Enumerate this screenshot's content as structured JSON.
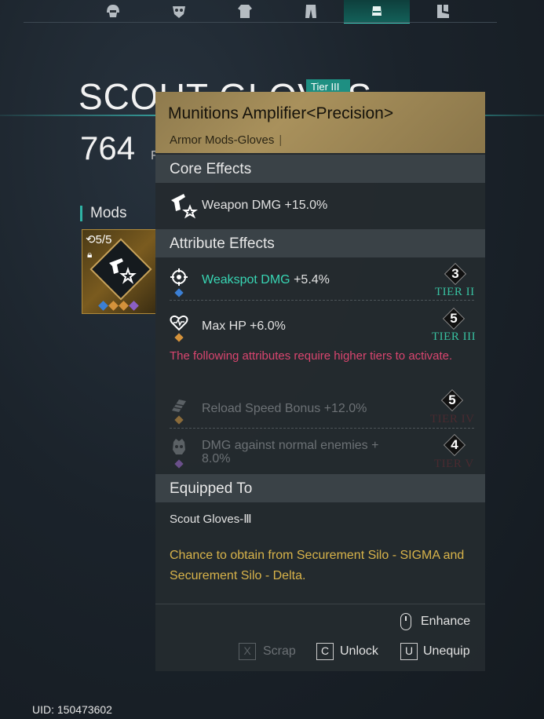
{
  "nav": {
    "tabs": [
      {
        "icon": "helmet-icon",
        "active": false
      },
      {
        "icon": "mask-icon",
        "active": false
      },
      {
        "icon": "top-armor-icon",
        "active": false
      },
      {
        "icon": "pants-icon",
        "active": false
      },
      {
        "icon": "gloves-icon",
        "active": true
      },
      {
        "icon": "boots-icon",
        "active": false
      }
    ]
  },
  "item": {
    "name": "SCOUT GLOVES",
    "tier_badge": "Tier III",
    "level": "764",
    "level_suffix": "F"
  },
  "mods": {
    "label": "Mods",
    "count": "5/5",
    "gem_colors": [
      "#3b7fd4",
      "#d4923b",
      "#d4923b",
      "#8b5fc4"
    ]
  },
  "tooltip": {
    "title": "Munitions Amplifier<Precision>",
    "subtitle": "Armor Mods-Gloves",
    "core_effects": {
      "heading": "Core Effects",
      "label": "Weapon DMG",
      "value": "+15.0%"
    },
    "attribute_effects": {
      "heading": "Attribute Effects",
      "items": [
        {
          "label": "Weakspot DMG",
          "value": "+5.4%",
          "number": "3",
          "tier": "TIER",
          "tier_roman": "II",
          "gem": "#3b7fd4",
          "active": true
        },
        {
          "label": "Max HP",
          "value": "+6.0%",
          "number": "5",
          "tier": "TIER",
          "tier_roman": "III",
          "gem": "#d4923b",
          "active": true
        }
      ],
      "warning": "The following attributes require higher tiers to activate.",
      "locked": [
        {
          "label": "Reload Speed Bonus",
          "value": "+12.0%",
          "number": "5",
          "tier": "TIER",
          "tier_roman": "IV",
          "gem": "#8a6b3a"
        },
        {
          "label": "DMG against normal enemies +",
          "value": "8.0%",
          "number": "4",
          "tier": "TIER",
          "tier_roman": "V",
          "gem": "#6a4f8a"
        }
      ]
    },
    "equipped": {
      "heading": "Equipped To",
      "value": "Scout Gloves-Ⅲ"
    },
    "source": "Chance to obtain from Securement Silo - SIGMA and Securement Silo - Delta.",
    "actions": {
      "enhance": "Enhance",
      "scrap_key": "X",
      "scrap": "Scrap",
      "unlock_key": "C",
      "unlock": "Unlock",
      "unequip_key": "U",
      "unequip": "Unequip"
    }
  },
  "uid": "UID: 150473602",
  "colors": {
    "accent": "#3fd8c6",
    "header_gold": "#a9915c",
    "green_text": "#38d6b4",
    "warning_red": "#d9456f",
    "source_gold": "#d8b34a",
    "tier_green": "#38c0a0"
  }
}
